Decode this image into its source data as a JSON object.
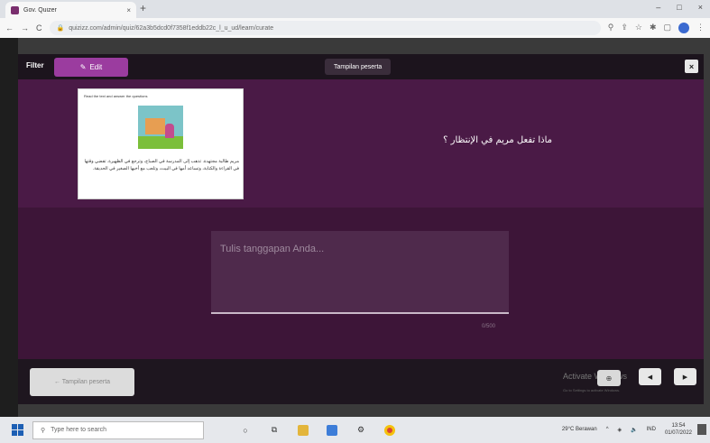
{
  "browser": {
    "tab_title": "Gov. Quizer",
    "tab_close": "×",
    "new_tab": "+",
    "window_controls": [
      "–",
      "□",
      "×"
    ],
    "url": "quizizz.com/admin/quiz/62a3b5dcd0f7358f1eddb22c_l_u_ud/learn/curate",
    "nav_icons": [
      "←",
      "→",
      "C"
    ]
  },
  "modal": {
    "left_label": "Filter",
    "edit_tab_label": "Edit",
    "preview_badge": "Tampilan peserta",
    "close": "×",
    "question": {
      "text": "ماذا تفعل مريم في الإنتظار ؟",
      "card_title": "Read the text and answer the questions",
      "card_body": "مريم طالبة مجتهدة. تذهب إلى المدرسة في الصباح، وترجع في الظهيرة. تقضي وقتها في القراءة والكتابة، وتساعد أمها في البيت، وتلعب مع أخيها الصغير في الحديقة."
    },
    "answer": {
      "placeholder": "Tulis tanggapan Anda...",
      "char_count": "0/500"
    },
    "footer": {
      "left_button": "← Tampilan peserta",
      "activate_text": "Activate Windows",
      "activate_sub": "Go to Settings to activate Windows.",
      "zoom_label": "⊕",
      "prev_label": "◀",
      "next_label": "▶"
    }
  },
  "taskbar": {
    "search_placeholder": "Type here to search",
    "weather": "29°C Berawan",
    "time": "13:54",
    "date": "01/07/2022",
    "lang": "IND"
  },
  "colors": {
    "accent": "#9b3c9f",
    "question_bg": "#4a1a46",
    "answer_bg": "#3d1538"
  }
}
